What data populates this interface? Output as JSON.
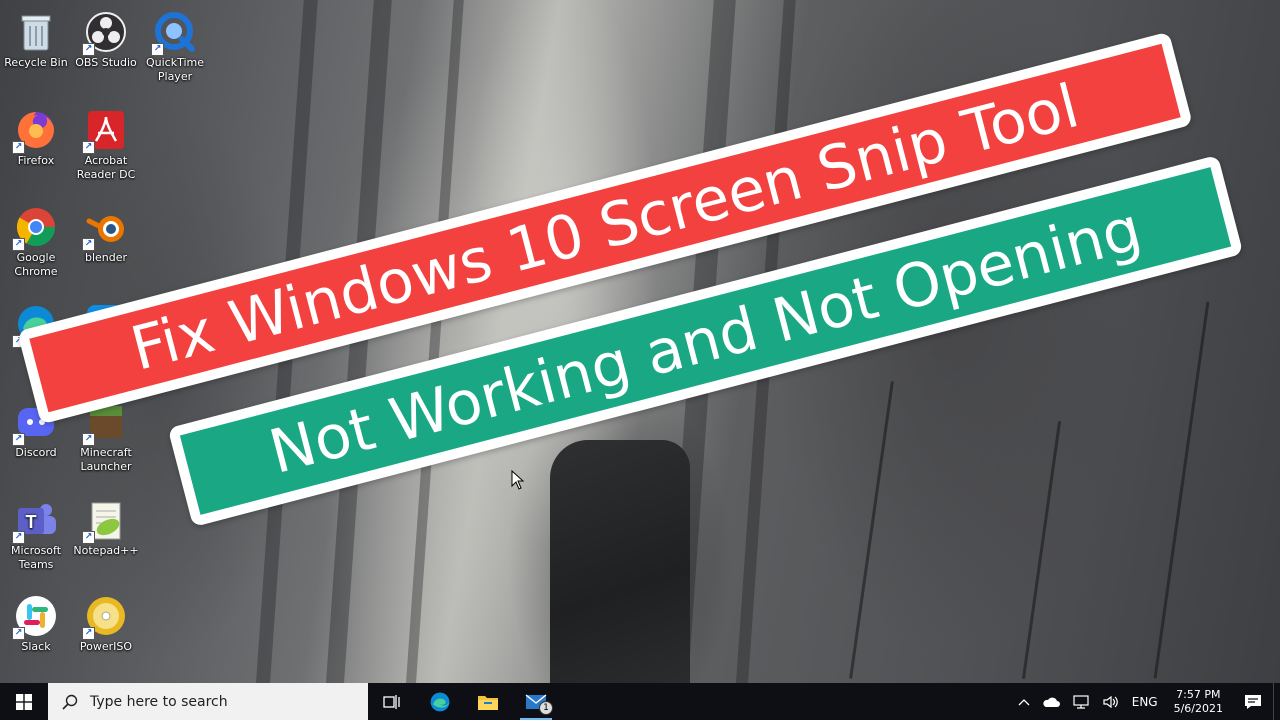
{
  "desktop": {
    "icons": [
      {
        "label": "Recycle Bin",
        "icon": "recycle-bin-icon",
        "color": "#9fb7c9"
      },
      {
        "label": "OBS Studio",
        "icon": "obs-studio-icon",
        "color": "#302e31"
      },
      {
        "label": "QuickTime Player",
        "icon": "quicktime-icon",
        "color": "#1e73d6"
      },
      {
        "label": "Firefox",
        "icon": "firefox-icon",
        "color": "#ff7139"
      },
      {
        "label": "Acrobat Reader DC",
        "icon": "acrobat-icon",
        "color": "#d7252a"
      },
      {
        "label": "Google Chrome",
        "icon": "chrome-icon",
        "color": "#4285f4"
      },
      {
        "label": "blender",
        "icon": "blender-icon",
        "color": "#ea7600"
      },
      {
        "label": "",
        "icon": "edge-icon",
        "color": "#0c8ad6"
      },
      {
        "label": "",
        "icon": "teamviewer-icon",
        "color": "#0e8ee9"
      },
      {
        "label": "Discord",
        "icon": "discord-icon",
        "color": "#5865f2"
      },
      {
        "label": "Minecraft Launcher",
        "icon": "minecraft-icon",
        "color": "#5a8d3a"
      },
      {
        "label": "Microsoft Teams",
        "icon": "teams-icon",
        "color": "#5b5fc7"
      },
      {
        "label": "Notepad++",
        "icon": "notepadpp-icon",
        "color": "#8dc63f"
      },
      {
        "label": "Slack",
        "icon": "slack-icon",
        "color": "#ffffff"
      },
      {
        "label": "PowerISO",
        "icon": "poweriso-icon",
        "color": "#e8b923"
      }
    ]
  },
  "banners": {
    "line1": "Fix Windows 10 Screen Snip Tool",
    "line2": "Not Working and  Not Opening",
    "line1_color": "#f2413f",
    "line2_color": "#19a883"
  },
  "taskbar": {
    "search_placeholder": "Type here to search",
    "apps": [
      {
        "icon": "task-view-icon"
      },
      {
        "icon": "edge-icon"
      },
      {
        "icon": "file-explorer-icon"
      },
      {
        "icon": "mail-icon",
        "badge": "1"
      }
    ],
    "tray": {
      "language": "ENG",
      "time": "7:57 PM",
      "date": "5/6/2021"
    }
  }
}
